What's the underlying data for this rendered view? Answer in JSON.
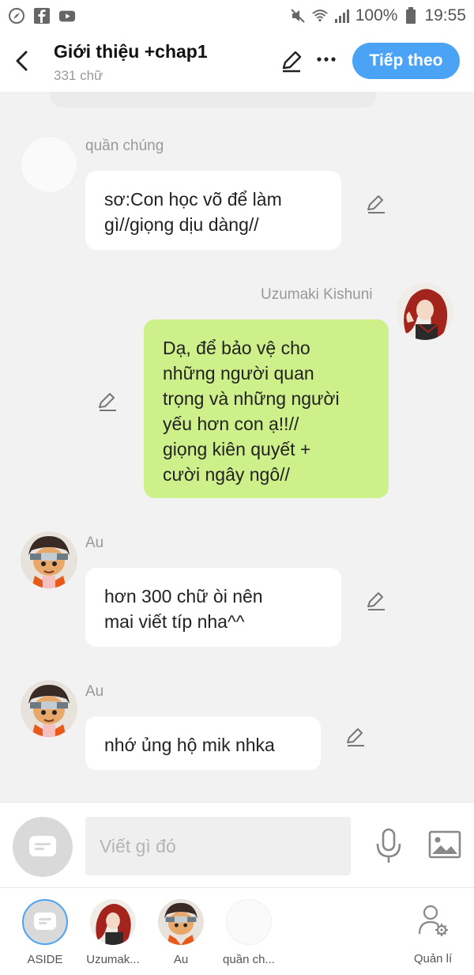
{
  "status_bar": {
    "battery": "100%",
    "time": "19:55",
    "left_icons": [
      "compass-icon",
      "facebook-icon",
      "youtube-icon"
    ],
    "right_icons": [
      "mute-icon",
      "wifi-icon",
      "signal-icon",
      "battery-icon"
    ]
  },
  "header": {
    "title": "Giới thiệu +chap1",
    "word_count": "331 chữ",
    "next_button": "Tiếp theo"
  },
  "messages": [
    {
      "sender": "quần chúng",
      "text_lines": [
        "sơ:Con học võ để làm",
        "gì//giọng dịu dàng//"
      ],
      "side": "left"
    },
    {
      "sender": "Uzumaki Kishuni",
      "text_lines": [
        "Dạ, để bảo vệ cho",
        "những người quan",
        "trọng và những người",
        "yếu hơn con ạ!!//",
        "giọng kiên quyết +",
        "cười ngây ngô//"
      ],
      "side": "right"
    },
    {
      "sender": "Au",
      "text_lines": [
        "hơn 300 chữ òi nên",
        "mai viết típ nha^^"
      ],
      "side": "left"
    },
    {
      "sender": "Au",
      "text_lines": [
        "nhớ ủng hộ mik nhka"
      ],
      "side": "left"
    }
  ],
  "composer": {
    "placeholder": "Viết gì đó"
  },
  "characters": [
    {
      "label": "ASIDE"
    },
    {
      "label": "Uzumak..."
    },
    {
      "label": "Au"
    },
    {
      "label": "quần ch..."
    }
  ],
  "manage_label": "Quản lí",
  "colors": {
    "accent": "#4aa3f5",
    "my_bubble": "#cdf08a",
    "background": "#f2f2f2"
  }
}
